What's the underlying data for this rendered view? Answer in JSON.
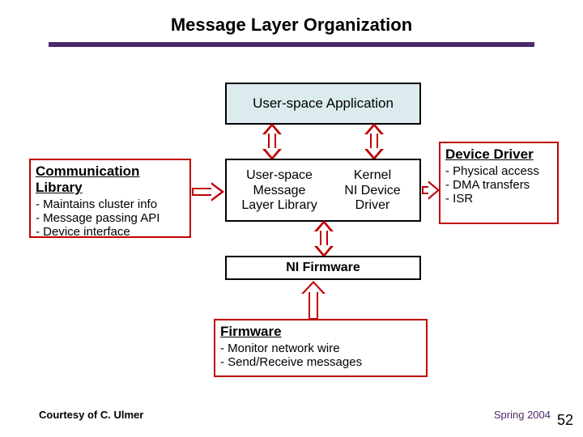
{
  "title": "Message Layer Organization",
  "boxes": {
    "app": "User-space Application",
    "mid_left_l1": "User-space",
    "mid_left_l2": "Message",
    "mid_left_l3": "Layer Library",
    "mid_right_l1": "Kernel",
    "mid_right_l2": "NI Device",
    "mid_right_l3": "Driver",
    "firmware": "NI Firmware"
  },
  "callouts": {
    "comm_lib": {
      "header": "Communication Library",
      "items": [
        "- Maintains cluster info",
        "- Message passing API",
        "- Device interface"
      ]
    },
    "dev_driver": {
      "header": "Device Driver",
      "items": [
        "- Physical access",
        "- DMA transfers",
        "- ISR"
      ]
    },
    "firmware": {
      "header": "Firmware",
      "items": [
        "- Monitor network wire",
        "- Send/Receive messages"
      ]
    }
  },
  "footer": {
    "courtesy": "Courtesy of C. Ulmer",
    "term": "Spring 2004",
    "page": "52"
  }
}
